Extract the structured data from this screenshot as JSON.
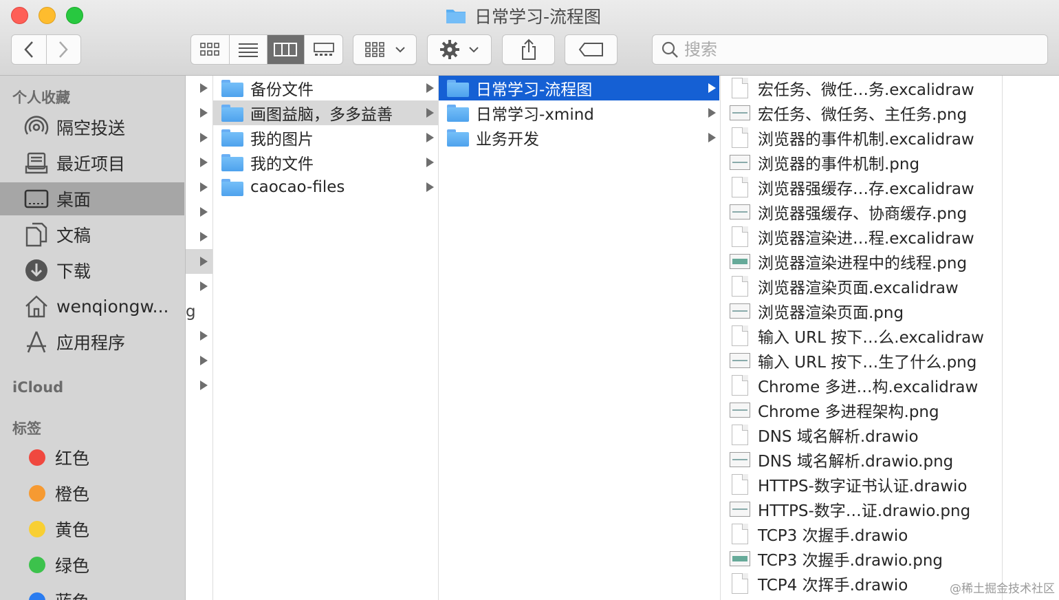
{
  "window": {
    "title": "日常学习-流程图",
    "colors": {
      "selection": "#1560d4",
      "sidebar_bg": "#d5d5d5",
      "folder": "#5aaff2"
    }
  },
  "toolbar": {
    "back_icon": "chevron-left-icon",
    "forward_icon": "chevron-right-icon",
    "view_modes": [
      "icon-view",
      "list-view",
      "column-view",
      "gallery-view"
    ],
    "active_view": "column-view",
    "search_placeholder": "搜索"
  },
  "sidebar": {
    "favorites_header": "个人收藏",
    "favorites": [
      {
        "label": "隔空投送",
        "icon": "airdrop-icon"
      },
      {
        "label": "最近项目",
        "icon": "recents-icon"
      },
      {
        "label": "桌面",
        "icon": "desktop-icon",
        "selected": true
      },
      {
        "label": "文稿",
        "icon": "documents-icon"
      },
      {
        "label": "下载",
        "icon": "downloads-icon"
      },
      {
        "label": "wenqiongw...",
        "icon": "home-icon"
      },
      {
        "label": "应用程序",
        "icon": "applications-icon"
      }
    ],
    "icloud_header": "iCloud",
    "tags_header": "标签",
    "tags": [
      {
        "label": "红色",
        "color": "#f0483f"
      },
      {
        "label": "橙色",
        "color": "#f69a32"
      },
      {
        "label": "黄色",
        "color": "#f8cf33"
      },
      {
        "label": "绿色",
        "color": "#3cc24c"
      },
      {
        "label": "蓝色",
        "color": "#2a7cf0"
      }
    ]
  },
  "column2": {
    "items": [
      {
        "label": "备份文件"
      },
      {
        "label": "画图益脑，多多益善",
        "highlighted": true
      },
      {
        "label": "我的图片"
      },
      {
        "label": "我的文件"
      },
      {
        "label": "caocao-files"
      }
    ]
  },
  "column3": {
    "items": [
      {
        "label": "日常学习-流程图",
        "selected": true
      },
      {
        "label": "日常学习-xmind"
      },
      {
        "label": "业务开发"
      }
    ]
  },
  "column4": {
    "items": [
      {
        "label": "宏任务、微任…务.excalidraw",
        "kind": "doc"
      },
      {
        "label": "宏任务、微任务、主任务.png",
        "kind": "image"
      },
      {
        "label": "浏览器的事件机制.excalidraw",
        "kind": "doc"
      },
      {
        "label": "浏览器的事件机制.png",
        "kind": "image"
      },
      {
        "label": "浏览器强缓存…存.excalidraw",
        "kind": "doc"
      },
      {
        "label": "浏览器强缓存、协商缓存.png",
        "kind": "image"
      },
      {
        "label": "浏览器渲染进…程.excalidraw",
        "kind": "doc"
      },
      {
        "label": "浏览器渲染进程中的线程.png",
        "kind": "image-color"
      },
      {
        "label": "浏览器渲染页面.excalidraw",
        "kind": "doc"
      },
      {
        "label": "浏览器渲染页面.png",
        "kind": "image"
      },
      {
        "label": "输入 URL 按下…么.excalidraw",
        "kind": "doc"
      },
      {
        "label": "输入 URL 按下…生了什么.png",
        "kind": "image"
      },
      {
        "label": "Chrome 多进…构.excalidraw",
        "kind": "doc"
      },
      {
        "label": "Chrome 多进程架构.png",
        "kind": "image"
      },
      {
        "label": "DNS 域名解析.drawio",
        "kind": "doc"
      },
      {
        "label": "DNS 域名解析.drawio.png",
        "kind": "image"
      },
      {
        "label": "HTTPS-数字证书认证.drawio",
        "kind": "doc"
      },
      {
        "label": "HTTPS-数字…证.drawio.png",
        "kind": "image"
      },
      {
        "label": "TCP3 次握手.drawio",
        "kind": "doc"
      },
      {
        "label": "TCP3 次握手.drawio.png",
        "kind": "image-color"
      },
      {
        "label": "TCP4 次挥手.drawio",
        "kind": "doc"
      }
    ]
  },
  "watermark": "@稀土掘金技术社区",
  "stray_char": "g"
}
